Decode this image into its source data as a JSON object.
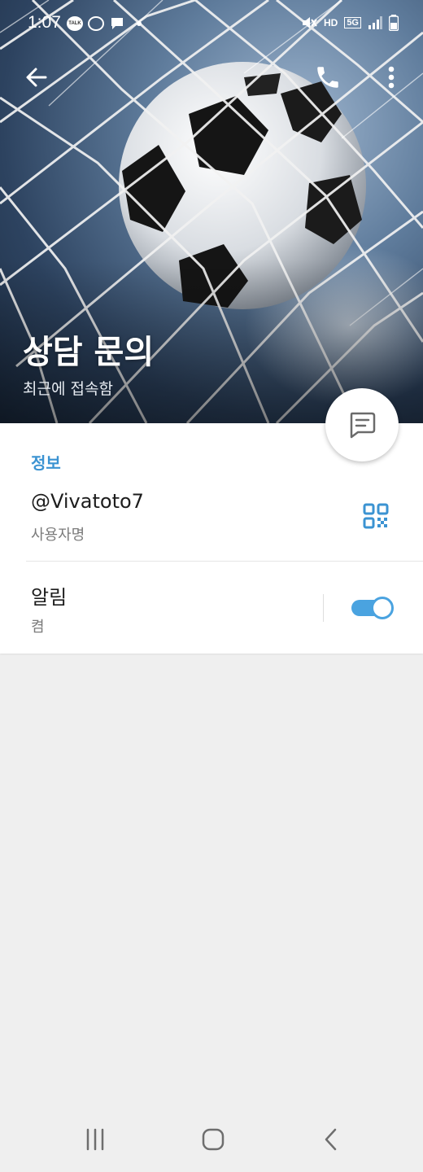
{
  "status_bar": {
    "time": "1:07",
    "notification_icons": [
      "talk-icon",
      "bot-icon",
      "message-icon"
    ],
    "right_icons": [
      "mute-icon",
      "hd-voice-icon",
      "5g-icon",
      "signal-icon",
      "battery-icon"
    ],
    "hd_label": "HD",
    "net_label": "5G"
  },
  "profile": {
    "name": "상담 문의",
    "last_seen": "최근에 접속함"
  },
  "info": {
    "section_title": "정보",
    "username": "@Vivatoto7",
    "username_caption": "사용자명",
    "notifications_label": "알림",
    "notifications_state": "켬",
    "notifications_on": true
  },
  "colors": {
    "accent": "#3b93d2",
    "toggle": "#4aa3e0",
    "background": "#efefef"
  }
}
